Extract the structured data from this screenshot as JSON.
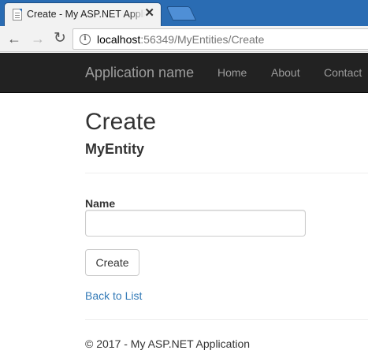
{
  "browser": {
    "tab": {
      "title": "Create - My ASP.NET Application",
      "close_glyph": "✕",
      "favicon": "page-icon"
    },
    "toolbar": {
      "back_glyph": "←",
      "forward_glyph": "→",
      "reload_glyph": "↻",
      "info_glyph": "i",
      "url_host": "localhost",
      "url_rest": ":56349/MyEntities/Create"
    },
    "colors": {
      "tabstrip": "#2a6cb3",
      "navbar": "#222222",
      "link": "#337ab7"
    }
  },
  "navbar": {
    "brand": "Application name",
    "links": [
      "Home",
      "About",
      "Contact"
    ]
  },
  "main": {
    "title": "Create",
    "subtitle": "MyEntity",
    "form": {
      "name_label": "Name",
      "name_value": "",
      "submit_label": "Create"
    },
    "back_link": "Back to List"
  },
  "footer": {
    "text": "© 2017 - My ASP.NET Application"
  }
}
